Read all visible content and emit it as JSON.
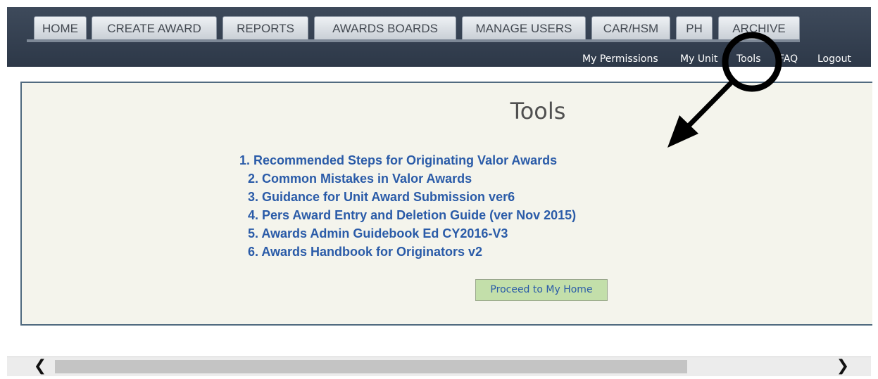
{
  "tabs": [
    "HOME",
    "CREATE AWARD",
    "REPORTS",
    "AWARDS BOARDS",
    "MANAGE USERS",
    "CAR/HSM",
    "PH",
    "ARCHIVE"
  ],
  "top_links": {
    "my_permissions": "My Permissions",
    "my_unit": "My Unit",
    "tools": "Tools",
    "faq": "FAQ",
    "logout": "Logout"
  },
  "page": {
    "title": "Tools",
    "links": [
      "1. Recommended Steps for Originating Valor Awards",
      "2. Common Mistakes in Valor Awards",
      "3. Guidance for Unit Award Submission ver6",
      "4. Pers Award Entry and Deletion Guide (ver Nov 2015)",
      "5. Awards Admin Guidebook Ed CY2016-V3",
      "6. Awards Handbook for Originators v2"
    ],
    "proceed_button": "Proceed to My Home"
  },
  "scrollbar": {
    "left_arrow": "❮",
    "right_arrow": "❯"
  },
  "colors": {
    "nav_bar": "#3e4a5b",
    "panel_bg": "#f4f4ec",
    "panel_border": "#506a7f",
    "link": "#2a5ba8",
    "button_bg": "#c3dfaa"
  }
}
